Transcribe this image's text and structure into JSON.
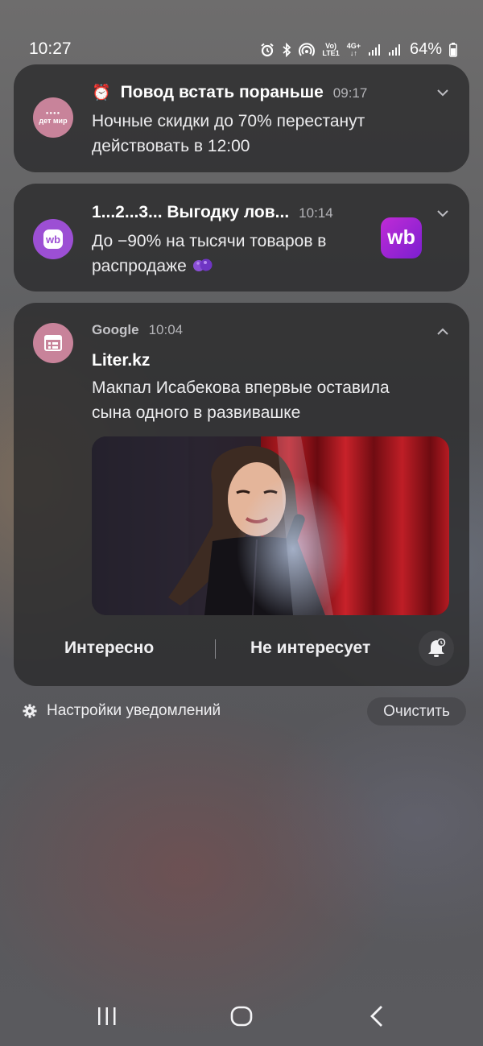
{
  "status_bar": {
    "time": "10:27",
    "network_top": "Vo)",
    "network_bottom": "LTE1",
    "network_4g": "4G+",
    "battery": "64%",
    "icons": [
      "alarm-icon",
      "bluetooth-icon",
      "hotspot-icon",
      "signal-icon",
      "signal-icon",
      "battery-icon"
    ]
  },
  "notifications": [
    {
      "app_icon_text": "дет мир",
      "title_emoji": "⏰",
      "title": "Повод встать пораньше",
      "time": "09:17",
      "body_line1": "Ночные скидки до 70% перестанут",
      "body_line2": "действовать в 12:00",
      "icon_color": "#c8839a"
    },
    {
      "app_icon_text": "wb",
      "title": "1...2...3... Выгодку лов...",
      "time": "10:14",
      "body_line1": "До −90% на тысячи товаров в",
      "body_line2": "распродаже",
      "large_icon_text": "wb",
      "icon_color": "#9c4fd4"
    },
    {
      "app_name": "Google",
      "time": "10:04",
      "title": "Liter.kz",
      "body_line1": "Макпал Исабекова впервые оставила",
      "body_line2": "сына одного в развивашке",
      "action_interesting": "Интересно",
      "action_not_interesting": "Не интересует",
      "icon_color": "#c8839a"
    }
  ],
  "footer": {
    "settings_label": "Настройки уведомлений",
    "clear_label": "Очистить"
  },
  "colors": {
    "card_bg": "#2a2a2c",
    "accent_pink": "#c8839a",
    "wb_purple": "#9c4fd4"
  }
}
